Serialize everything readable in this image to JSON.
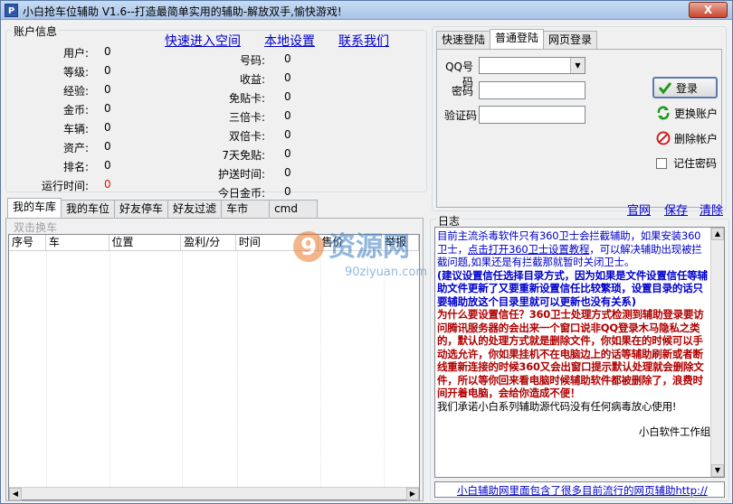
{
  "window": {
    "icon_text": "P",
    "title": "小白抢车位辅助 V1.6--打造最简单实用的辅助-解放双手,愉快游戏!",
    "close_label": "X"
  },
  "account": {
    "legend": "账户信息",
    "links": [
      "快速进入空间",
      "本地设置",
      "联系我们"
    ],
    "left_fields": [
      {
        "label": "用户:",
        "value": "0"
      },
      {
        "label": "等级:",
        "value": "0"
      },
      {
        "label": "经验:",
        "value": "0"
      },
      {
        "label": "金币:",
        "value": "0"
      },
      {
        "label": "车辆:",
        "value": "0"
      },
      {
        "label": "资产:",
        "value": "0"
      },
      {
        "label": "排名:",
        "value": "0"
      },
      {
        "label": "运行时间:",
        "value": "0"
      }
    ],
    "right_fields": [
      {
        "label": "号码:",
        "value": "0"
      },
      {
        "label": "收益:",
        "value": "0"
      },
      {
        "label": "免贴卡:",
        "value": "0"
      },
      {
        "label": "三倍卡:",
        "value": "0"
      },
      {
        "label": "双倍卡:",
        "value": "0"
      },
      {
        "label": "7天免贴:",
        "value": "0"
      },
      {
        "label": "护送时间:",
        "value": "0"
      },
      {
        "label": "今日金币:",
        "value": "0"
      }
    ]
  },
  "login": {
    "tabs": [
      "快速登陆",
      "普通登陆",
      "网页登录"
    ],
    "active_tab": "普通登陆",
    "qq_label": "QQ号码",
    "password_label": "密码",
    "captcha_label": "验证码",
    "qq_value": "",
    "password_value": "",
    "captcha_value": "",
    "login_button": "登录",
    "switch_button": "更换账户",
    "delete_button": "删除帐户",
    "remember_label": "记住密码"
  },
  "car_tabs": [
    "我的车库",
    "我的车位",
    "好友停车",
    "好友过滤",
    "车市",
    "cmd"
  ],
  "active_car_tab": "我的车库",
  "swap_label": "双击换车",
  "table": {
    "columns": [
      "序号",
      "车",
      "位置",
      "盈利/分",
      "时间",
      "售价",
      "举报"
    ]
  },
  "actions": [
    "官网",
    "保存",
    "清除"
  ],
  "log": {
    "legend": "日志",
    "para1": "目前主流杀毒软件只有360卫士会拦截辅助，如果安装360卫士，",
    "para1_link": "点击打开360卫士设置教程",
    "para1_rest": "，可以解决辅助出现被拦截问题,如果还是有拦截那就暂时关闭卫士。",
    "para2": "(建议设置信任选择目录方式，因为如果是文件设置信任等辅助文件更新了又要重新设置信任比较繁琐，设置目录的话只要辅助放这个目录里就可以更新也没有关系)",
    "para3": "为什么要设置信任？360卫士处理方式检测到辅助登录要访问腾讯服务器的会出来一个窗口说非QQ登录木马隐私之类的，默认的处理方式就是删除文件，你如果在的时候可以手动选允许，你如果挂机不在电脑边上的话等辅助刷新或者断线重新连接的时候360又会出窗口提示默认处理就会删除文件，所以等你回来看电脑时候辅助软件都被删除了，浪费时间开着电脑，会给你造成不便！",
    "para4": "我们承诺小白系列辅助源代码没有任何病毒放心使用!",
    "signature": "小白软件工作组"
  },
  "status": {
    "text": "小白辅助网里面包含了很多目前流行的网页辅助http://"
  },
  "watermark": {
    "big": "9资源网",
    "small": "90ziyuan.com"
  }
}
